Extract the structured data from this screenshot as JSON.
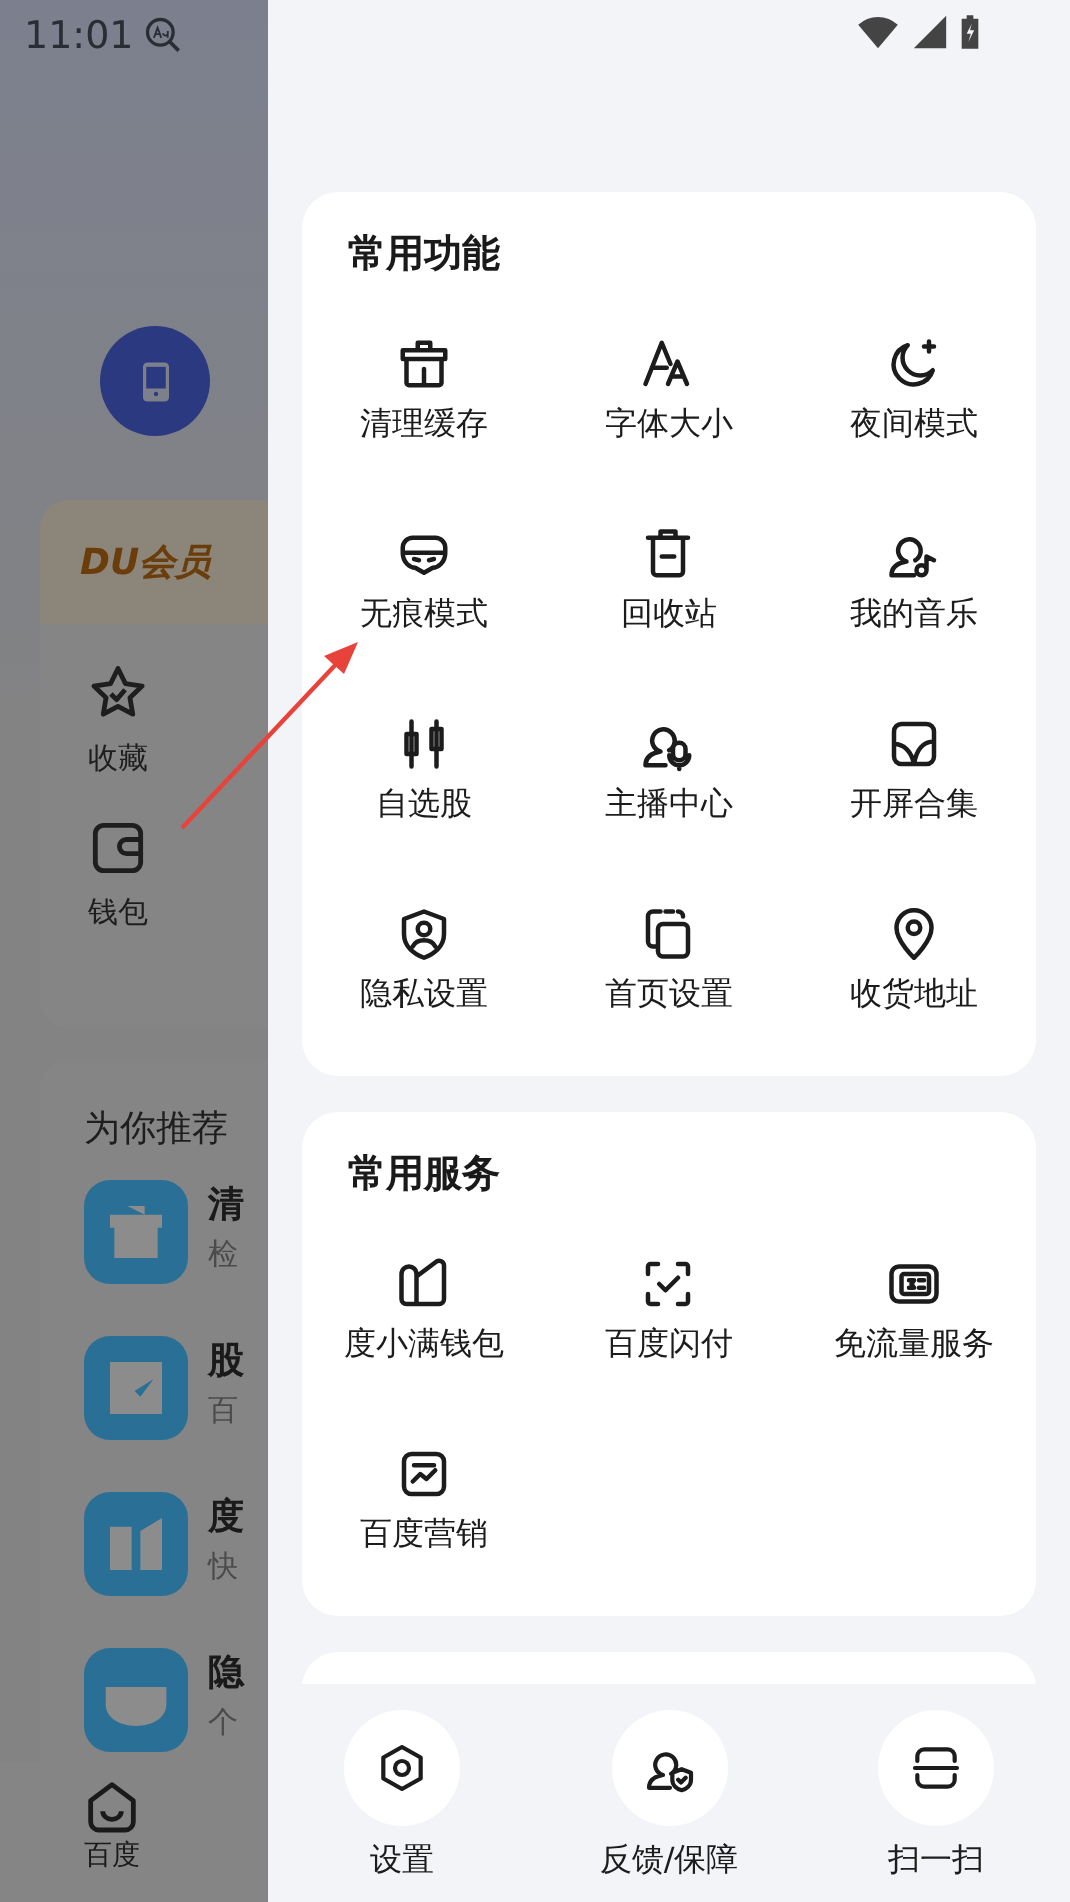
{
  "status_bar": {
    "time": "11:01"
  },
  "background_page": {
    "du_card": {
      "brand": "DU会员"
    },
    "shortcuts": [
      {
        "label": "收藏"
      },
      {
        "label": "钱包"
      }
    ],
    "recommend": {
      "title": "为你推荐",
      "items": [
        {
          "title": "清",
          "subtitle": "检"
        },
        {
          "title": "股",
          "subtitle": "百"
        },
        {
          "title": "度",
          "subtitle": "快"
        },
        {
          "title": "隐",
          "subtitle": "个"
        }
      ]
    },
    "bottom_nav": [
      {
        "label": "百度"
      }
    ]
  },
  "drawer": {
    "sections": [
      {
        "title": "常用功能",
        "items": [
          "清理缓存",
          "字体大小",
          "夜间模式",
          "无痕模式",
          "回收站",
          "我的音乐",
          "自选股",
          "主播中心",
          "开屏合集",
          "隐私设置",
          "首页设置",
          "收货地址"
        ]
      },
      {
        "title": "常用服务",
        "items": [
          "度小满钱包",
          "百度闪付",
          "免流量服务",
          "百度营销"
        ]
      }
    ],
    "bottom_actions": [
      "设置",
      "反馈/保障",
      "扫一扫"
    ]
  }
}
